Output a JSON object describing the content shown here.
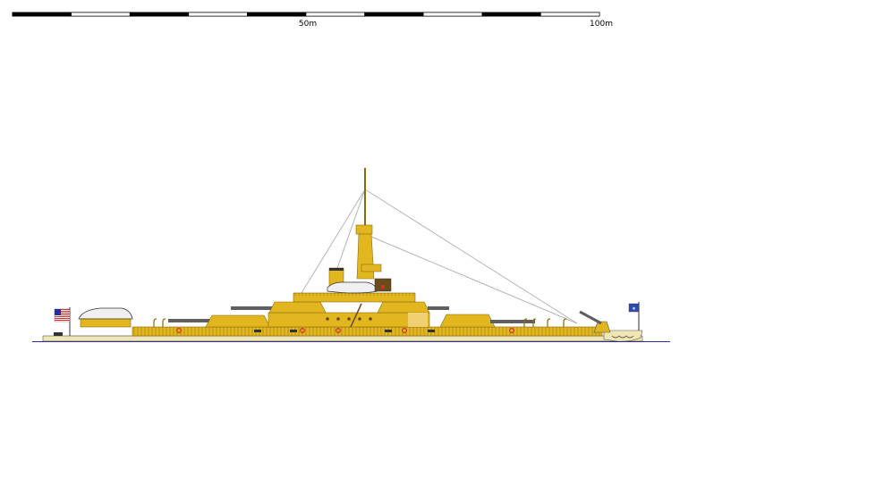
{
  "scale_bar": {
    "labels": [
      "50m",
      "100m"
    ],
    "colors": {
      "dark": "#000000",
      "light": "#ffffff",
      "outline": "#000000"
    }
  },
  "ship": {
    "hull_color": "#f0e6b4",
    "superstructure_color": "#e2b61f",
    "shadow_color": "#c49a12",
    "gun_color": "#5f5f5f",
    "rigging_color": "#b4b4b4",
    "waterline_color": "#2a2aa8",
    "stern_flag": "us-flag-icon",
    "bow_flag": "jack-flag-icon"
  }
}
